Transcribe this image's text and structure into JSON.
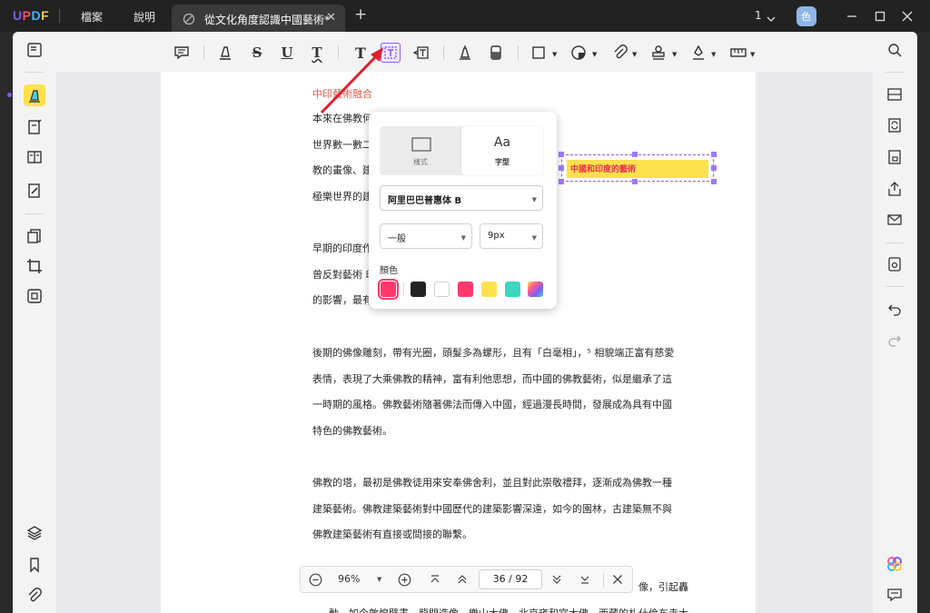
{
  "app": {
    "logo": "UPDF"
  },
  "menu": {
    "file": "檔案",
    "help": "說明"
  },
  "tab": {
    "title": "從文化角度認識中國藝術*",
    "close": "✕",
    "new": "+"
  },
  "titlebar": {
    "page_number": "1",
    "avatar_initial": "色"
  },
  "document": {
    "heading": "中印藝術融合",
    "paragraphs": [
      "本來在佛教何      法、繪畫和建築等的精美，在\n世界數一數二      長處，中印藝術融合，令到佛\n教的畫像、建      塔寺、塔和宮殿的壯麗，仿似\n極樂世界的建",
      "早期的印度作      事藝術。佛陀在世間弘法，未\n曾反對藝術      印度佛教藝術受希臘文藝復興\n的影響，最有",
      "後期的佛像雕刻，帶有光圈，頭髮多為螺形，且有「白毫相」，⁵ 相貌端正富有慈愛\n表情，表現了大乘佛教的精神，富有利他思想，而中國的佛教藝術，似是繼承了這\n一時期的風格。佛教藝術隨著佛法而傳入中國，經過漫長時間，發展成為具有中國\n特色的佛教藝術。",
      "佛教的塔，最初是佛教徒用來安奉佛舍利，並且對此崇敬禮拜，逐漸成為佛教一種\n建築藝術。佛教建築藝術對中國歷代的建築影響深遠，如今的園林，古建築無不與\n佛教建築藝術有直接或間接的聯繫。",
      "像，引起轟\n動。如今敦煌壁畫，龍門造像，樂山大佛，北京雍和宮大佛，西藏的札什倫布寺大"
    ],
    "textbox_text": "中國和印度的藝術"
  },
  "popup": {
    "tab_style": "樣式",
    "tab_font": "字型",
    "font_glyph": "Aa",
    "font_family": "阿里巴巴普惠体 B",
    "font_weight": "一般",
    "font_size": "9px",
    "color_label": "顏色",
    "current_color": "#ff3a6a",
    "colors": [
      "#222222",
      "#ffffff",
      "#ff3a6a",
      "#ffe14d",
      "#3dd6c0",
      "rainbow"
    ]
  },
  "zoombar": {
    "zoom": "96%",
    "page": "36 / 92"
  },
  "toolbar_icons": [
    "comment-icon",
    "highlight-icon",
    "strikethrough-icon",
    "underline-icon",
    "squiggly-underline-icon",
    "text-icon",
    "textbox-icon",
    "text-callout-icon",
    "pencil-icon",
    "eraser-icon",
    "shape-icon",
    "sticker-icon",
    "attachment-icon",
    "stamp-icon",
    "signature-icon",
    "measure-icon"
  ],
  "toolbar_glyphs": {
    "strike": "S",
    "underline": "U",
    "squiggly": "T",
    "text": "T"
  }
}
